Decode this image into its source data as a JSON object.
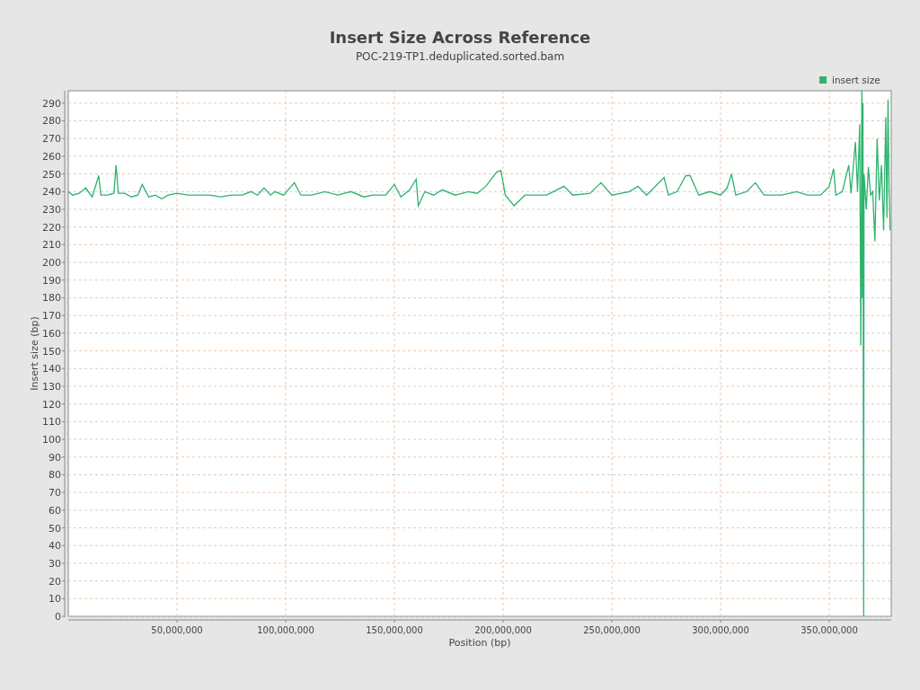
{
  "title": "Insert Size Across Reference",
  "subtitle": "POC-219-TP1.deduplicated.sorted.bam",
  "chart_data": {
    "type": "line",
    "grid": true,
    "xlabel": "Position (bp)",
    "ylabel": "Insert size (bp)",
    "xlim": [
      0,
      378500000
    ],
    "ylim": [
      0,
      297
    ],
    "xticks": [
      {
        "value": 50000000,
        "label": "50,000,000"
      },
      {
        "value": 100000000,
        "label": "100,000,000"
      },
      {
        "value": 150000000,
        "label": "150,000,000"
      },
      {
        "value": 200000000,
        "label": "200,000,000"
      },
      {
        "value": 250000000,
        "label": "250,000,000"
      },
      {
        "value": 300000000,
        "label": "300,000,000"
      },
      {
        "value": 350000000,
        "label": "350,000,000"
      }
    ],
    "yticks": [
      0,
      10,
      20,
      30,
      40,
      50,
      60,
      70,
      80,
      90,
      100,
      110,
      120,
      130,
      140,
      150,
      160,
      170,
      180,
      190,
      200,
      210,
      220,
      230,
      240,
      250,
      260,
      270,
      280,
      290
    ],
    "x": [
      0,
      2000000,
      5000000,
      8000000,
      11000000,
      14000000,
      15000000,
      18000000,
      21000000,
      22000000,
      23000000,
      26000000,
      29000000,
      32000000,
      34000000,
      37000000,
      40000000,
      43000000,
      46000000,
      50000000,
      55000000,
      60000000,
      65000000,
      70000000,
      75000000,
      80000000,
      84000000,
      87000000,
      90000000,
      93000000,
      95000000,
      99000000,
      104000000,
      107000000,
      112000000,
      118000000,
      124000000,
      130000000,
      136000000,
      140000000,
      146000000,
      150000000,
      153000000,
      157000000,
      160000000,
      161000000,
      164000000,
      168000000,
      172000000,
      178000000,
      184000000,
      188000000,
      192000000,
      197000000,
      199000000,
      201000000,
      205000000,
      210000000,
      220000000,
      228000000,
      232000000,
      240000000,
      245000000,
      250000000,
      258000000,
      262000000,
      266000000,
      274000000,
      276000000,
      280000000,
      284000000,
      286000000,
      290000000,
      295000000,
      300000000,
      303000000,
      305000000,
      307000000,
      312000000,
      316000000,
      320000000,
      328000000,
      335000000,
      340000000,
      346000000,
      350000000,
      352000000,
      353000000,
      356000000,
      359000000,
      360000000,
      362000000,
      363000000,
      364000000,
      364500000,
      365000000,
      365200000,
      365500000,
      365800000,
      366000000,
      367000000,
      368000000,
      369000000,
      370000000,
      371000000,
      372000000,
      373000000,
      374000000,
      375000000,
      376000000,
      376500000,
      377000000,
      377500000,
      378000000
    ],
    "series": [
      {
        "name": "insert size",
        "color": "#2db36e",
        "values": [
          240,
          238,
          239,
          242,
          237,
          249,
          238,
          238,
          239,
          255,
          239,
          239,
          237,
          238,
          244,
          237,
          238,
          236,
          238,
          239,
          238,
          238,
          238,
          237,
          238,
          238,
          240,
          238,
          242,
          238,
          240,
          238,
          245,
          238,
          238,
          240,
          238,
          240,
          237,
          238,
          238,
          244,
          237,
          241,
          247,
          232,
          240,
          238,
          241,
          238,
          240,
          239,
          243,
          251,
          252,
          238,
          232,
          238,
          238,
          243,
          238,
          239,
          245,
          238,
          240,
          243,
          238,
          248,
          238,
          240,
          249,
          249,
          238,
          240,
          238,
          242,
          250,
          238,
          240,
          245,
          238,
          238,
          240,
          238,
          238,
          243,
          253,
          238,
          240,
          255,
          239,
          268,
          240,
          278,
          153,
          297,
          180,
          290,
          0,
          250,
          230,
          254,
          238,
          240,
          212,
          270,
          235,
          255,
          218,
          282,
          225,
          292,
          240,
          218
        ]
      }
    ]
  }
}
